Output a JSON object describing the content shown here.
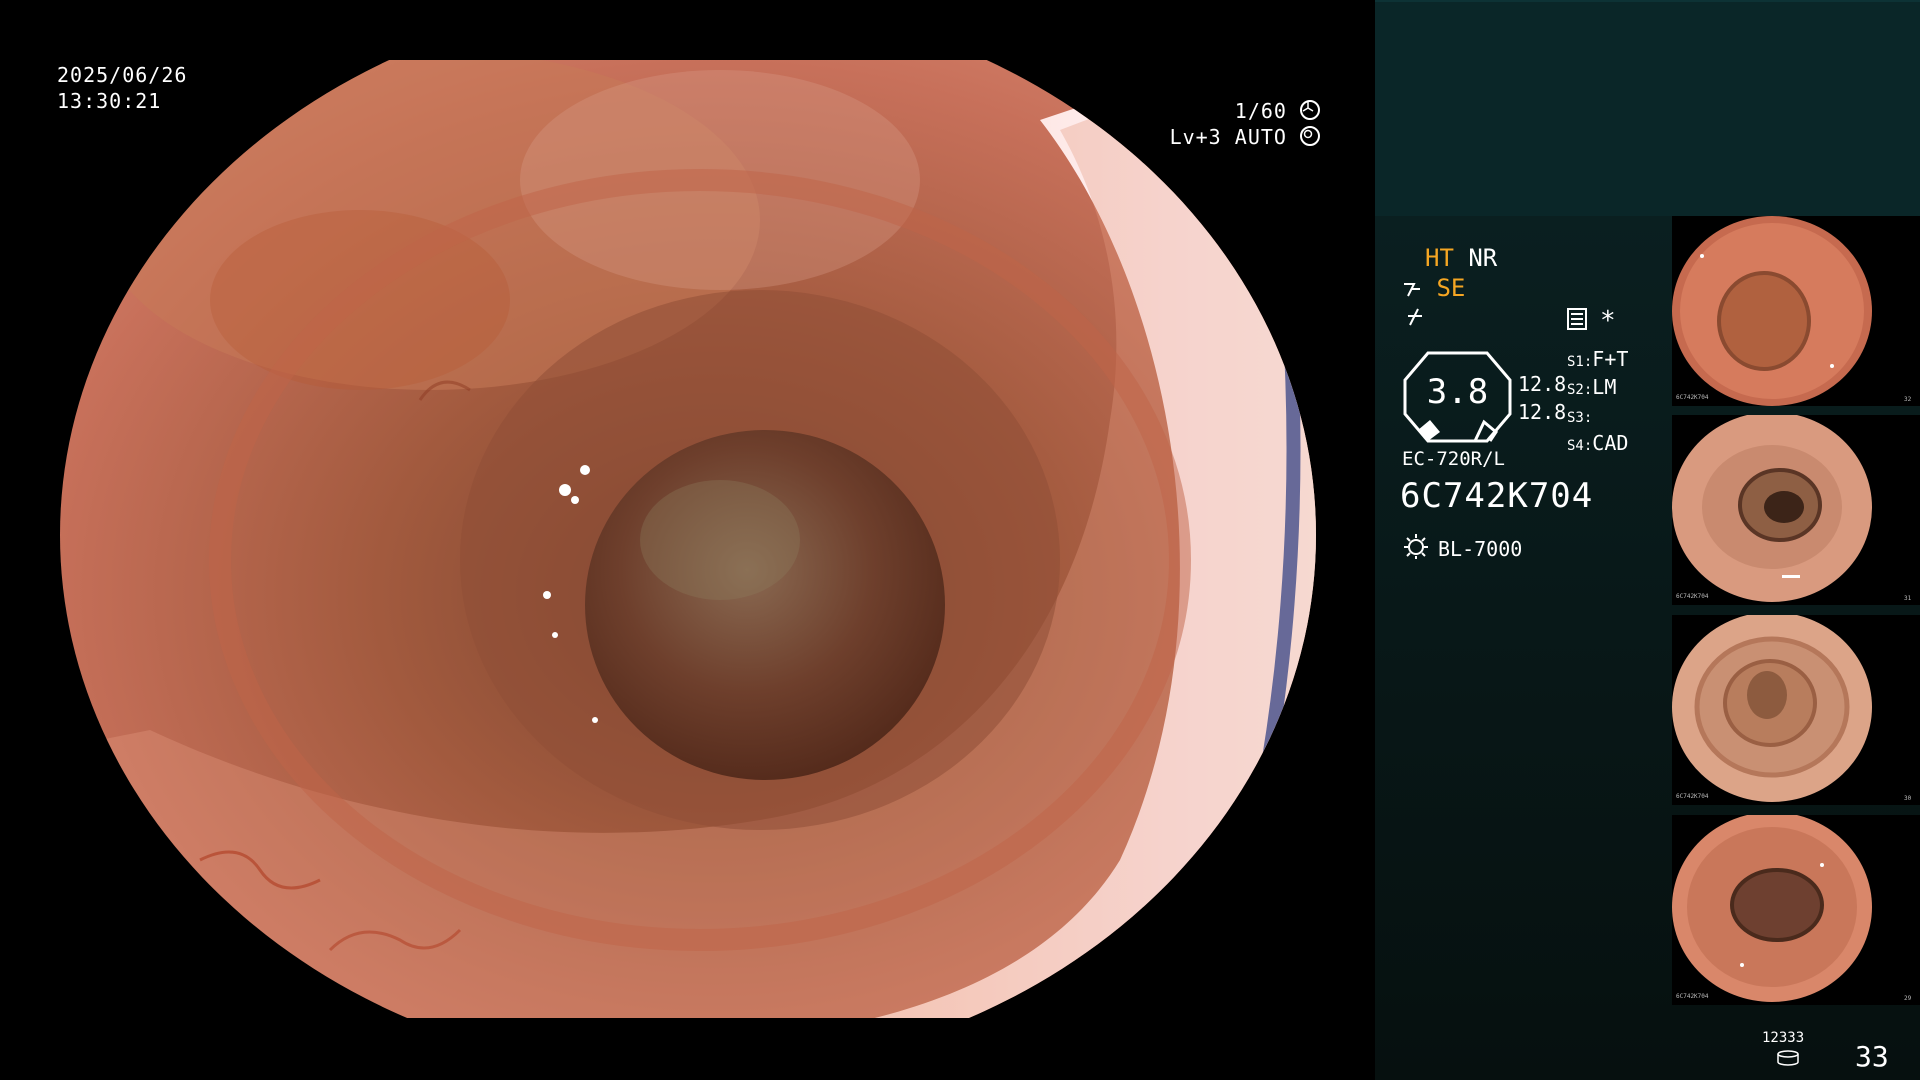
{
  "overlay": {
    "date": "2025/06/26",
    "time": "13:30:21",
    "shutter": "1/60",
    "level": "Lv+3",
    "iris_mode": "AUTO"
  },
  "panel": {
    "ht": "HT",
    "nr": "NR",
    "se": "SE",
    "asterisk": "*",
    "zoom_value": "3.8",
    "num1": "12.8",
    "num2": "12.8",
    "s1_label": "S1:",
    "s1_value": "F+T",
    "s2_label": "S2:",
    "s2_value": "LM",
    "s3_label": "S3:",
    "s3_value": "",
    "s4_label": "S4:",
    "s4_value": "CAD",
    "scope_model": "EC-720R/L",
    "serial": "6C742K704",
    "light_source": "BL-7000"
  },
  "storage": {
    "count": "12333",
    "images": "33"
  },
  "thumbnails": [
    {
      "number": "32",
      "serial": "6C742K704"
    },
    {
      "number": "31",
      "serial": "6C742K704"
    },
    {
      "number": "30",
      "serial": "6C742K704"
    },
    {
      "number": "29",
      "serial": "6C742K704"
    }
  ],
  "colors": {
    "accent_yellow": "#f5a623",
    "panel_dark": "#0a2628",
    "tissue_pink": "#d97a5f",
    "tissue_dark": "#6a3a26"
  }
}
